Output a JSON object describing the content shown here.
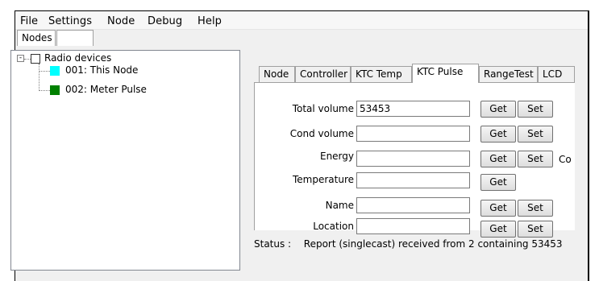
{
  "menu": [
    "File",
    "Settings",
    "Node",
    "Debug",
    "Help"
  ],
  "nodes_tabs": [
    "Nodes",
    ""
  ],
  "tree": {
    "root_label": "Radio devices",
    "root_expander": "-",
    "items": [
      {
        "label": "001: This Node",
        "color": "#00ffff"
      },
      {
        "label": "002: Meter Pulse",
        "color": "#008000"
      }
    ]
  },
  "tabs": [
    "Node",
    "Controller",
    "KTC Temp",
    "KTC Pulse",
    "RangeTest",
    "LCD"
  ],
  "active_tab": "KTC Pulse",
  "fields": [
    {
      "label": "Total volume",
      "value": "53453",
      "get": "Get",
      "set": "Set"
    },
    {
      "label": "Cond volume",
      "value": "",
      "get": "Get",
      "set": "Set"
    },
    {
      "label": "Energy",
      "value": "",
      "get": "Get",
      "set": "Set"
    },
    {
      "label": "Temperature",
      "value": "",
      "get": "Get"
    },
    {
      "label": "Name",
      "value": "",
      "get": "Get",
      "set": "Set"
    },
    {
      "label": "Location",
      "value": "",
      "get": "Get",
      "set": "Set"
    }
  ],
  "clipped_text": "Co",
  "status": {
    "label": "Status :",
    "text": "Report (singlecast) received from 2 containing 53453"
  },
  "colors": {
    "window_bg": "#f0f0f0",
    "panel_bg": "#ffffff"
  }
}
